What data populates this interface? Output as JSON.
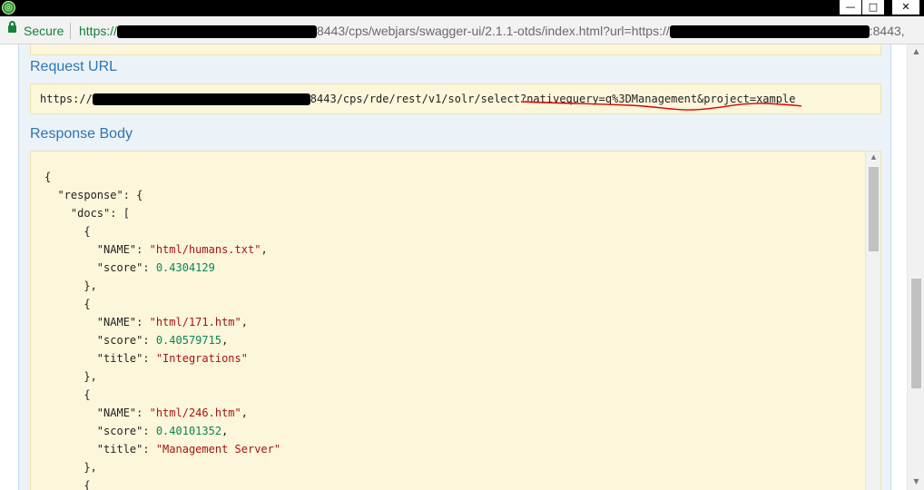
{
  "window": {
    "minimize_glyph": "—",
    "maximize_glyph": "□",
    "close_glyph": "✕",
    "app_icon": "chrome-app-icon"
  },
  "addressbar": {
    "security_label": "Secure",
    "url_scheme": "https://",
    "url_rest": "8443/cps/webjars/swagger-ui/2.1.1-otds/index.html?url=https://",
    "url_tail": ":8443,"
  },
  "panel": {
    "request_url_label": "Request URL",
    "request_url": {
      "scheme": "https://",
      "path": "8443/cps/rde/rest/v1/solr/select?nativequery=q%3DManagement&project=xample"
    },
    "response_body_label": "Response Body"
  },
  "response_lines": [
    {
      "indent": "",
      "parts": [
        {
          "t": "p",
          "v": "{"
        }
      ]
    },
    {
      "indent": "  ",
      "parts": [
        {
          "t": "k",
          "v": "\"response\""
        },
        {
          "t": "p",
          "v": ": {"
        }
      ]
    },
    {
      "indent": "    ",
      "parts": [
        {
          "t": "k",
          "v": "\"docs\""
        },
        {
          "t": "p",
          "v": ": ["
        }
      ]
    },
    {
      "indent": "      ",
      "parts": [
        {
          "t": "p",
          "v": "{"
        }
      ]
    },
    {
      "indent": "        ",
      "parts": [
        {
          "t": "k",
          "v": "\"NAME\""
        },
        {
          "t": "p",
          "v": ": "
        },
        {
          "t": "s",
          "v": "\"html/humans.txt\""
        },
        {
          "t": "p",
          "v": ","
        }
      ]
    },
    {
      "indent": "        ",
      "parts": [
        {
          "t": "k",
          "v": "\"score\""
        },
        {
          "t": "p",
          "v": ": "
        },
        {
          "t": "n",
          "v": "0.4304129"
        }
      ]
    },
    {
      "indent": "      ",
      "parts": [
        {
          "t": "p",
          "v": "},"
        }
      ]
    },
    {
      "indent": "      ",
      "parts": [
        {
          "t": "p",
          "v": "{"
        }
      ]
    },
    {
      "indent": "        ",
      "parts": [
        {
          "t": "k",
          "v": "\"NAME\""
        },
        {
          "t": "p",
          "v": ": "
        },
        {
          "t": "s",
          "v": "\"html/171.htm\""
        },
        {
          "t": "p",
          "v": ","
        }
      ]
    },
    {
      "indent": "        ",
      "parts": [
        {
          "t": "k",
          "v": "\"score\""
        },
        {
          "t": "p",
          "v": ": "
        },
        {
          "t": "n",
          "v": "0.40579715"
        },
        {
          "t": "p",
          "v": ","
        }
      ]
    },
    {
      "indent": "        ",
      "parts": [
        {
          "t": "k",
          "v": "\"title\""
        },
        {
          "t": "p",
          "v": ": "
        },
        {
          "t": "s",
          "v": "\"Integrations\""
        }
      ]
    },
    {
      "indent": "      ",
      "parts": [
        {
          "t": "p",
          "v": "},"
        }
      ]
    },
    {
      "indent": "      ",
      "parts": [
        {
          "t": "p",
          "v": "{"
        }
      ]
    },
    {
      "indent": "        ",
      "parts": [
        {
          "t": "k",
          "v": "\"NAME\""
        },
        {
          "t": "p",
          "v": ": "
        },
        {
          "t": "s",
          "v": "\"html/246.htm\""
        },
        {
          "t": "p",
          "v": ","
        }
      ]
    },
    {
      "indent": "        ",
      "parts": [
        {
          "t": "k",
          "v": "\"score\""
        },
        {
          "t": "p",
          "v": ": "
        },
        {
          "t": "n",
          "v": "0.40101352"
        },
        {
          "t": "p",
          "v": ","
        }
      ]
    },
    {
      "indent": "        ",
      "parts": [
        {
          "t": "k",
          "v": "\"title\""
        },
        {
          "t": "p",
          "v": ": "
        },
        {
          "t": "s",
          "v": "\"Management Server\""
        }
      ]
    },
    {
      "indent": "      ",
      "parts": [
        {
          "t": "p",
          "v": "},"
        }
      ]
    },
    {
      "indent": "      ",
      "parts": [
        {
          "t": "p",
          "v": "{"
        }
      ]
    }
  ],
  "colors": {
    "accent_label": "#2f74b1",
    "code_bg": "#fcf6db",
    "string": "#a31515",
    "number": "#098658",
    "secure_green": "#188038",
    "annotation_red": "#e00000"
  },
  "scrollbar": {
    "up_glyph": "▲",
    "down_glyph": "▼"
  }
}
